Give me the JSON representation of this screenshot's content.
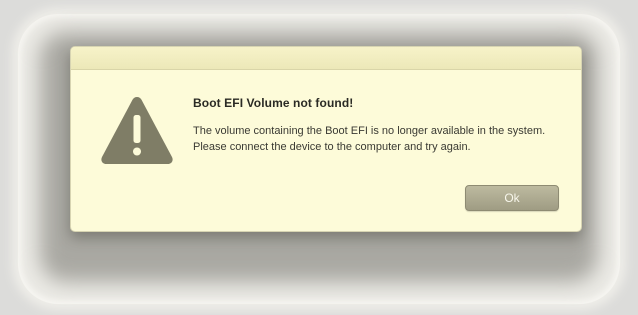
{
  "dialog": {
    "title": "Boot EFI Volume not found!",
    "message": "The volume containing the Boot EFI is no longer available in the system. Please connect the device to the computer and try again.",
    "ok_label": "Ok",
    "icon": "warning-triangle-icon"
  },
  "colors": {
    "dialog_background": "#fdfbd9",
    "icon_fill": "#7f7d66",
    "button_fill": "#aeab91"
  }
}
